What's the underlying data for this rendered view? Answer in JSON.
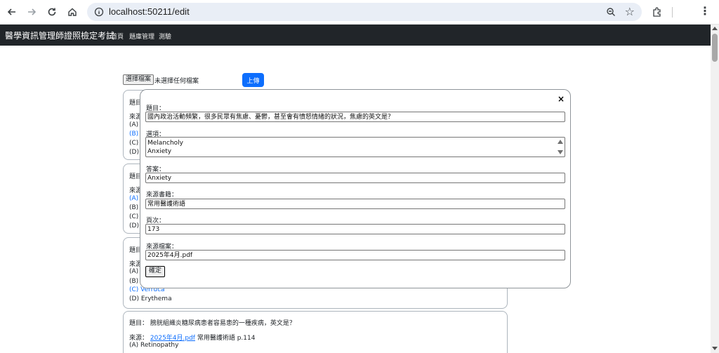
{
  "browser": {
    "url": "localhost:50211/edit"
  },
  "navbar": {
    "brand": "醫學資訊管理師證照檢定考試",
    "links": [
      "首頁",
      "題庫管理",
      "測驗"
    ]
  },
  "upload": {
    "choose_label": "選擇檔案",
    "status": "未選擇任何檔案",
    "upload_label": "上傳"
  },
  "cards": [
    {
      "title": "題目：",
      "lines": [
        "來源",
        "(A) I",
        "(B) A",
        "(C) I",
        "(D) I"
      ]
    },
    {
      "title": "題目",
      "lines": [
        "來源",
        "(A) C",
        "(B) F",
        "(C) F",
        "(D) F"
      ]
    },
    {
      "title": "題目",
      "lines": [
        "來源",
        "(A) N",
        "(B) F",
        "(C) Verruca",
        "(D) Erythema"
      ]
    },
    {
      "title": "題目： 膀胱組織炎糖尿病患者容易患的一種疾病，英文是？",
      "source_label": "來源：",
      "source_link": "2025年4月.pdf",
      "source_rest": "常用醫護術語 p.114",
      "lines": [
        "(A) Retinopathy"
      ]
    }
  ],
  "modal": {
    "close": "×",
    "question_label": "題目：",
    "question_value": "國內政治活動頻繁，很多民眾有焦慮、憂鬱，甚至會有憤怒情緒的狀況，焦慮的英文是？",
    "options_label": "選項：",
    "options_lines": [
      "Melancholy",
      "Anxiety"
    ],
    "answer_label": "答案：",
    "answer_value": "Anxiety",
    "book_label": "來源書籍：",
    "book_value": "常用醫護術語",
    "page_label": "頁次：",
    "page_value": "173",
    "file_label": "來源檔案：",
    "file_value": "2025年4月.pdf",
    "confirm": "確定"
  },
  "colors": {
    "navbar": "#212529",
    "primary": "#0d6efd"
  }
}
